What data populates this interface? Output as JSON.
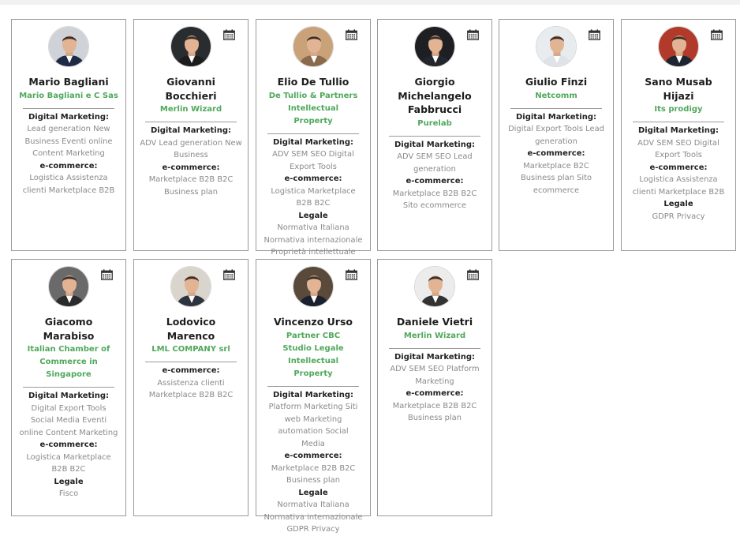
{
  "colors": {
    "accent_green": "#4fa85b",
    "border": "#9a9a9a",
    "text_muted": "#8a8a8a"
  },
  "calendar_icon": "calendar-icon",
  "members": [
    {
      "name": "Mario Bagliani",
      "company": "Mario Bagliani e C Sas",
      "show_calendar": false,
      "sections": [
        {
          "title": "Digital Marketing:",
          "items": "Lead generation New Business Eventi online Content Marketing"
        },
        {
          "title": "e-commerce:",
          "items": "Logistica Assistenza clienti Marketplace B2B"
        }
      ]
    },
    {
      "name": "Giovanni Bocchieri",
      "company": "Merlin Wizard",
      "show_calendar": true,
      "sections": [
        {
          "title": "Digital Marketing:",
          "items": "ADV Lead generation New Business"
        },
        {
          "title": "e-commerce:",
          "items": "Marketplace B2B B2C Business plan"
        }
      ]
    },
    {
      "name": "Elio De Tullio",
      "company": "De Tullio & Partners Intellectual Property",
      "show_calendar": true,
      "sections": [
        {
          "title": "Digital Marketing:",
          "items": "ADV SEM SEO Digital Export Tools"
        },
        {
          "title": "e-commerce:",
          "items": "Logistica Marketplace B2B B2C"
        },
        {
          "title": "Legale",
          "items": "Normativa Italiana Normativa internazionale Proprietà intellettuale"
        }
      ]
    },
    {
      "name": "Giorgio Michelangelo Fabbrucci",
      "company": "Purelab",
      "show_calendar": true,
      "sections": [
        {
          "title": "Digital Marketing:",
          "items": "ADV SEM SEO Lead generation"
        },
        {
          "title": "e-commerce:",
          "items": "Marketplace B2B B2C Sito ecommerce"
        }
      ]
    },
    {
      "name": "Giulio Finzi",
      "company": "Netcomm",
      "show_calendar": true,
      "sections": [
        {
          "title": "Digital Marketing:",
          "items": "Digital Export Tools Lead generation"
        },
        {
          "title": "e-commerce:",
          "items": "Marketplace B2C Business plan Sito ecommerce"
        }
      ]
    },
    {
      "name": "Sano Musab Hijazi",
      "company": "Its prodigy",
      "show_calendar": true,
      "sections": [
        {
          "title": "Digital Marketing:",
          "items": "ADV SEM SEO Digital Export Tools"
        },
        {
          "title": "e-commerce:",
          "items": "Logistica Assistenza clienti Marketplace B2B"
        },
        {
          "title": "Legale",
          "items": "GDPR Privacy"
        }
      ]
    },
    {
      "name": "Giacomo Marabiso",
      "company": "Italian Chamber of Commerce in Singapore",
      "show_calendar": true,
      "sections": [
        {
          "title": "Digital Marketing:",
          "items": "Digital Export Tools Social Media Eventi online Content Marketing"
        },
        {
          "title": "e-commerce:",
          "items": "Logistica Marketplace B2B B2C"
        },
        {
          "title": "Legale",
          "items": "Fisco"
        }
      ]
    },
    {
      "name": "Lodovico Marenco",
      "company": "LML COMPANY srl",
      "show_calendar": true,
      "sections": [
        {
          "title": "e-commerce:",
          "items": "Assistenza clienti Marketplace B2B B2C"
        }
      ]
    },
    {
      "name": "Vincenzo Urso",
      "company": "Partner CBC Studio Legale Intellectual Property",
      "show_calendar": true,
      "sections": [
        {
          "title": "Digital Marketing:",
          "items": "Platform Marketing Siti web Marketing automation Social Media"
        },
        {
          "title": "e-commerce:",
          "items": "Marketplace B2B B2C Business plan"
        },
        {
          "title": "Legale",
          "items": "Normativa Italiana Normativa internazionale GDPR Privacy"
        }
      ]
    },
    {
      "name": "Daniele Vietri",
      "company": "Merlin Wizard",
      "show_calendar": true,
      "sections": [
        {
          "title": "Digital Marketing:",
          "items": "ADV SEM SEO Platform Marketing"
        },
        {
          "title": "e-commerce:",
          "items": "Marketplace B2B B2C Business plan"
        }
      ]
    }
  ]
}
